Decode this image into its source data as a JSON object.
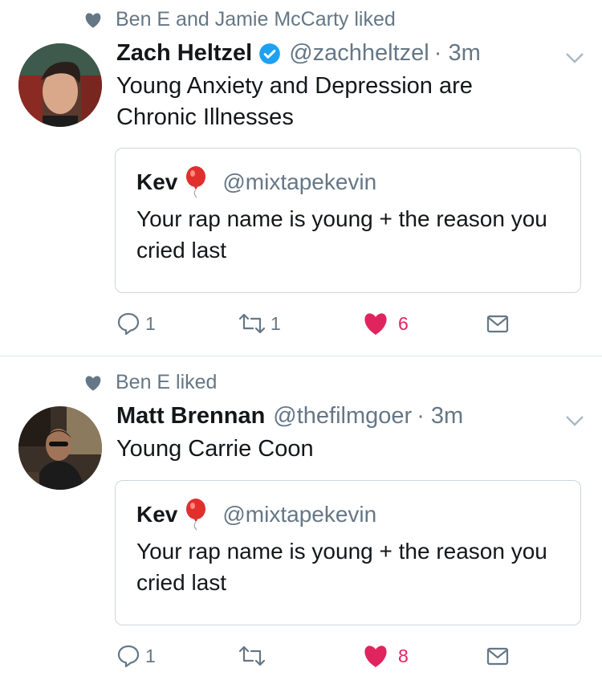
{
  "tweets": [
    {
      "social_context": "Ben E and Jamie McCarty liked",
      "name": "Zach Heltzel",
      "verified": true,
      "handle": "@zachheltzel",
      "time": "· 3m",
      "text": "Young Anxiety and Depression are Chronic Illnesses",
      "quote": {
        "name": "Kev",
        "emoji": "balloon-emoji",
        "handle": "@mixtapekevin",
        "text": "Your rap name is young + the reason you cried last"
      },
      "replies": "1",
      "retweets": "1",
      "likes": "6",
      "liked": true
    },
    {
      "social_context": "Ben E liked",
      "name": "Matt Brennan",
      "verified": false,
      "handle": "@thefilmgoer",
      "time": "· 3m",
      "text": "Young Carrie Coon",
      "quote": {
        "name": "Kev",
        "emoji": "balloon-emoji",
        "handle": "@mixtapekevin",
        "text": "Your rap name is young + the reason you cried last"
      },
      "replies": "1",
      "retweets": "",
      "likes": "8",
      "liked": true
    }
  ],
  "colors": {
    "like": "#e0245e",
    "verified": "#1da1f2",
    "muted": "#657786",
    "border": "#ccd6dd"
  }
}
